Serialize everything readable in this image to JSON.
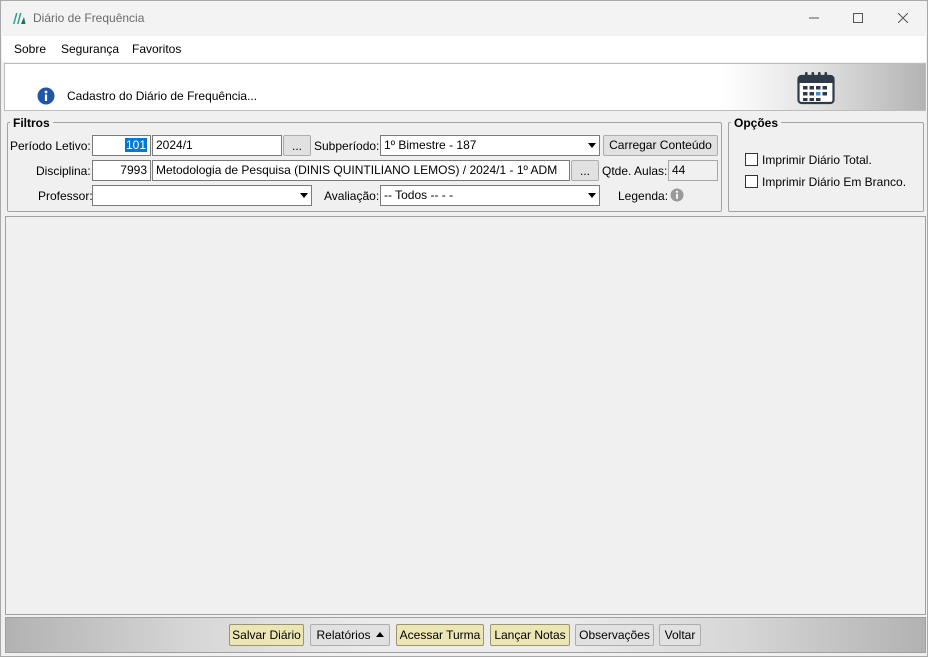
{
  "window": {
    "title": "Diário de Frequência"
  },
  "menu": [
    "Sobre",
    "Segurança",
    "Favoritos"
  ],
  "header": {
    "text": "Cadastro do Diário de Frequência..."
  },
  "filtros": {
    "legend": "Filtros",
    "periodo_label": "Período Letivo:",
    "periodo_code": "101",
    "periodo_value": "2024/1",
    "subperiodo_label": "Subperíodo:",
    "subperiodo_value": "1º Bimestre - 187",
    "carregar_label": "Carregar Conteúdo",
    "disciplina_label": "Disciplina:",
    "disciplina_code": "7993",
    "disciplina_value": "Metodologia de Pesquisa (DINIS QUINTILIANO LEMOS) / 2024/1 - 1º ADM",
    "qtde_label": "Qtde. Aulas:",
    "qtde_value": "44",
    "professor_label": "Professor:",
    "professor_value": "",
    "avaliacao_label": "Avaliação:",
    "avaliacao_value": "-- Todos -- -  -",
    "legenda_label": "Legenda:",
    "ellipsis": "..."
  },
  "opcoes": {
    "legend": "Opções",
    "imprimir_total": "Imprimir Diário Total.",
    "imprimir_branco": "Imprimir Diário Em Branco."
  },
  "footer": {
    "salvar": "Salvar Diário",
    "relatorios": "Relatórios",
    "acessar": "Acessar Turma",
    "lancar": "Lançar Notas",
    "observacoes": "Observações",
    "voltar": "Voltar"
  },
  "colors": {
    "accent_yellow": "#ece6b4",
    "info_blue": "#1e56a8",
    "selection": "#0078d7"
  }
}
